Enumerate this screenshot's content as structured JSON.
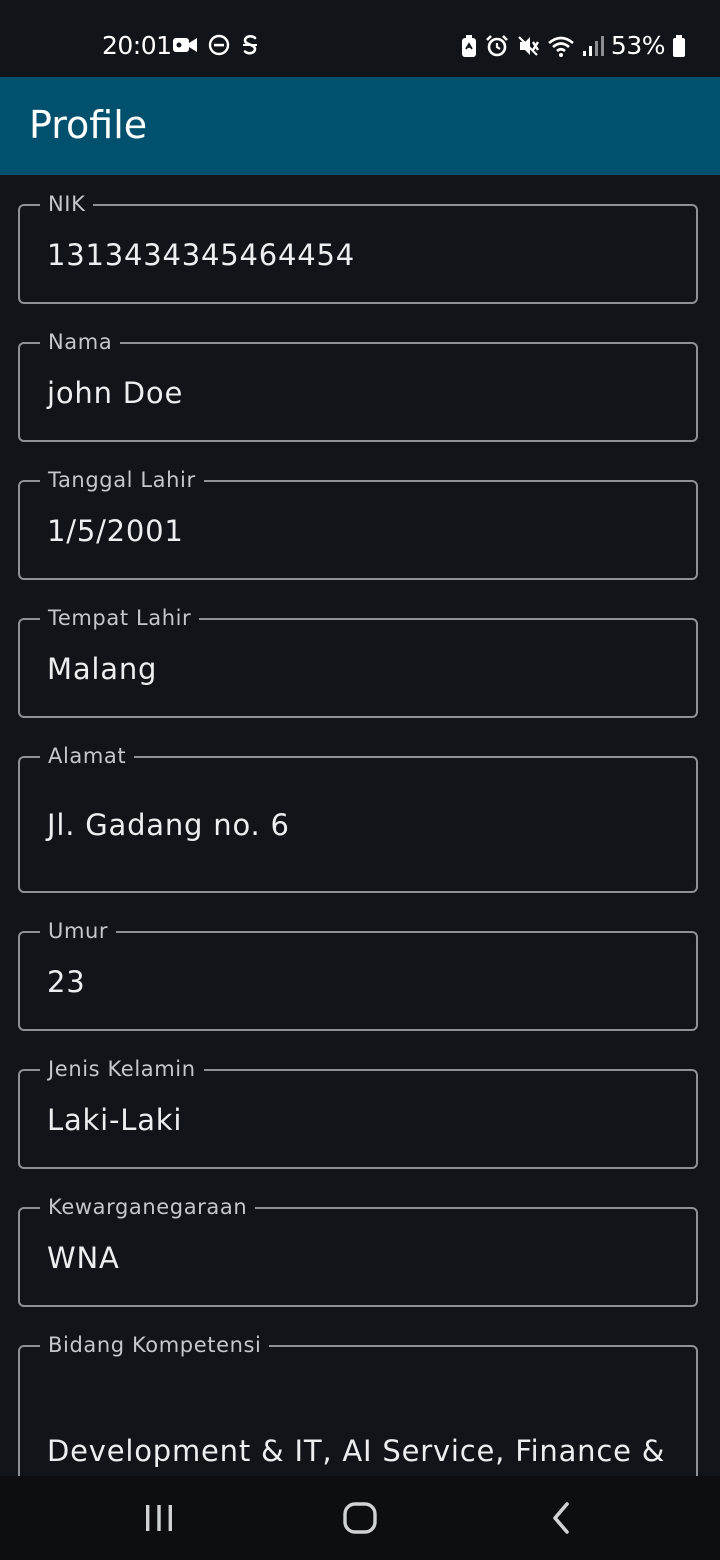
{
  "status_bar": {
    "time": "20:01",
    "battery_percent": "53%",
    "left_icons": [
      "video-camera-icon",
      "do-not-disturb-icon",
      "s-icon"
    ],
    "right_icons": [
      "battery-saver-icon",
      "alarm-icon",
      "vibrate-off-icon",
      "wifi-icon",
      "signal-icon",
      "battery-icon"
    ]
  },
  "app_bar": {
    "title": "Profile",
    "color": "#01506e"
  },
  "fields": [
    {
      "label": "NIK",
      "value": "1313434345464454"
    },
    {
      "label": "Nama",
      "value": "john Doe"
    },
    {
      "label": "Tanggal Lahir",
      "value": "1/5/2001"
    },
    {
      "label": "Tempat Lahir",
      "value": "Malang"
    },
    {
      "label": "Alamat",
      "value": "Jl. Gadang no. 6"
    },
    {
      "label": "Umur",
      "value": "23"
    },
    {
      "label": "Jenis Kelamin",
      "value": "Laki-Laki"
    },
    {
      "label": "Kewarganegaraan",
      "value": "WNA"
    },
    {
      "label": "Bidang Kompetensi",
      "value": "Development & IT, AI Service, Finance &"
    }
  ],
  "nav_bar": {
    "buttons": [
      "recents-icon",
      "home-icon",
      "back-icon"
    ]
  }
}
